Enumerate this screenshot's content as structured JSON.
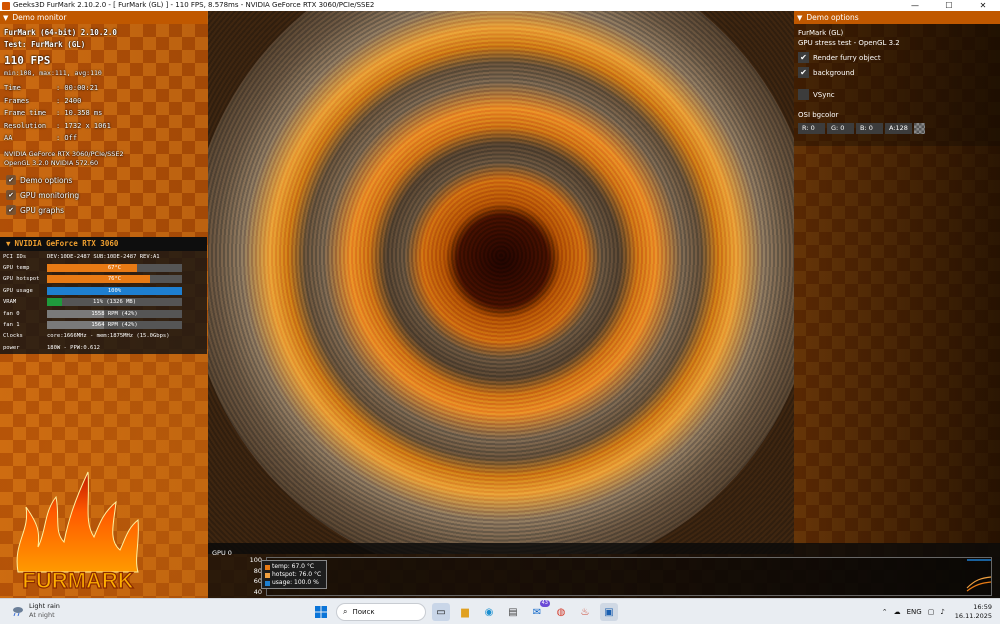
{
  "window": {
    "title": "Geeks3D FurMark 2.10.2.0 - [ FurMark (GL) ] - 110 FPS, 8.578ms - NVIDIA GeForce RTX 3060/PCIe/SSE2",
    "minimize": "—",
    "maximize": "☐",
    "close": "✕"
  },
  "demo_monitor": {
    "header": "Demo monitor",
    "app_line": "FurMark (64-bit) 2.10.2.0",
    "test_line": "Test: FurMark (GL)",
    "fps": "110 FPS",
    "minmax": "min:108, max:111, avg:110",
    "stats": [
      {
        "k": "Time",
        "v": ": 00:00:21"
      },
      {
        "k": "Frames",
        "v": ": 2400"
      },
      {
        "k": "Frame time",
        "v": ": 10.358 ms"
      },
      {
        "k": "Resolution",
        "v": ": 1732 x 1061"
      },
      {
        "k": "AA",
        "v": ": Off"
      }
    ],
    "gpu_renderer": "NVIDIA GeForce RTX 3060/PCIe/SSE2",
    "gl_version": "OpenGL 3.2.0 NVIDIA 572.60",
    "checkboxes": [
      {
        "label": "Demo options",
        "checked": true
      },
      {
        "label": "GPU monitoring",
        "checked": true
      },
      {
        "label": "GPU graphs",
        "checked": true
      }
    ]
  },
  "gpu_monitor": {
    "header": "NVIDIA GeForce RTX 3060",
    "pci_label": "PCI IDs",
    "pci_value": "DEV:10DE-2487 SUB:10DE-2487 REV:A1",
    "rows": [
      {
        "label": "GPU temp",
        "text": "67°C",
        "fill": 0.67,
        "color": "#e87a14"
      },
      {
        "label": "GPU hotspot",
        "text": "76°C",
        "fill": 0.76,
        "color": "#e87a14"
      },
      {
        "label": "GPU usage",
        "text": "100%",
        "fill": 1.0,
        "color": "#1e7fd0"
      },
      {
        "label": "VRAM",
        "text": "11% (1326 MB)",
        "fill": 0.11,
        "color": "#1f9a3c"
      },
      {
        "label": "fan 0",
        "text": "1558 RPM (42%)",
        "fill": 0.42,
        "color": "#7a7a7a"
      },
      {
        "label": "fan 1",
        "text": "1564 RPM (42%)",
        "fill": 0.42,
        "color": "#7a7a7a"
      }
    ],
    "clocks_label": "Clocks",
    "clocks_value": "core:1666MHz - mem:1875MHz (15.0Gbps)",
    "power_label": "power",
    "power_value": "180W - PPW:0.612"
  },
  "logo": {
    "text": "FURMARK"
  },
  "demo_options": {
    "header": "Demo options",
    "name": "FurMark (GL)",
    "desc": "GPU stress test - OpenGL 3.2",
    "render_furry": {
      "label": "Render furry object",
      "checked": true
    },
    "background": {
      "label": "background",
      "checked": true
    },
    "vsync": {
      "label": "VSync",
      "checked": false
    },
    "osi_label": "OSI bgcolor",
    "bg": {
      "r": "R: 0",
      "g": "G: 0",
      "b": "B: 0",
      "a": "A:128"
    }
  },
  "graph": {
    "title": "GPU 0",
    "y_ticks": [
      "100",
      "80",
      "60",
      "40"
    ],
    "legend": [
      {
        "label": "temp: 67.0 °C",
        "color": "#e87a14"
      },
      {
        "label": "hotspot: 76.0 °C",
        "color": "#f0a040"
      },
      {
        "label": "usage: 100.0 %",
        "color": "#1e7fd0"
      }
    ]
  },
  "taskbar": {
    "weather_title": "Light rain",
    "weather_sub": "At night",
    "search_placeholder": "Поиск",
    "lang": "ENG",
    "time": "16:59",
    "date": "16.11.2025",
    "mail_badge": "43"
  }
}
